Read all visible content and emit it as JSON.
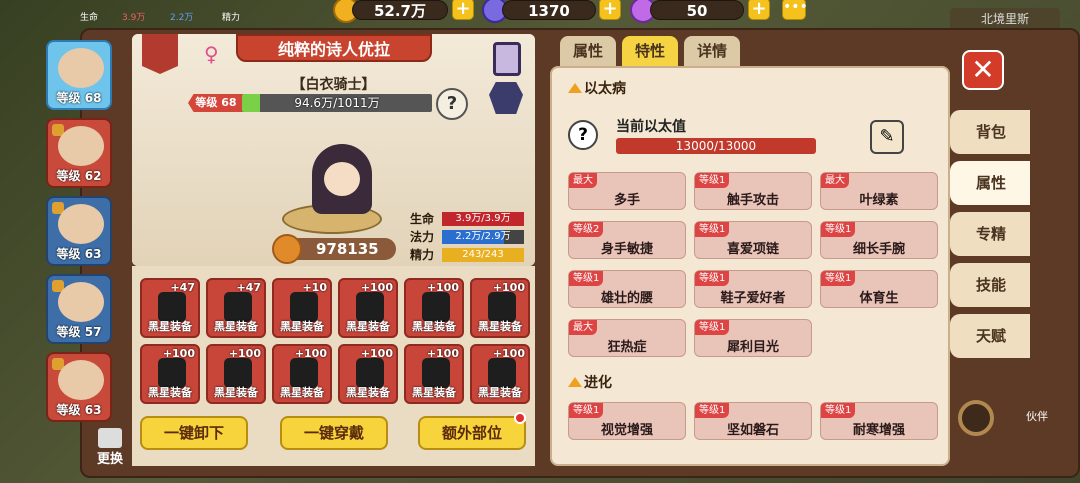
{
  "top": {
    "hud_hp": "生命",
    "hud_hp_value": "3.9万",
    "hud_mp_value": "2.2万",
    "hud_sp": "精力",
    "gold": "52.7万",
    "gems": "1370",
    "crystals": "50",
    "map_name": "北境里斯"
  },
  "heroes": [
    {
      "level": "等级 68",
      "selected": true
    },
    {
      "level": "等级 62"
    },
    {
      "level": "等级 63"
    },
    {
      "level": "等级 57"
    },
    {
      "level": "等级 63"
    }
  ],
  "swap_label": "更换",
  "character": {
    "name": "纯粹的诗人优拉",
    "subtitle": "【白衣骑士】",
    "level_label": "等级 68",
    "xp_text": "94.6万/1011万",
    "xp_fraction": 0.094,
    "help": "?",
    "power": "978135",
    "stats": [
      {
        "label": "生命",
        "value": "3.9万/3.9万",
        "fraction": 1.0,
        "color": "#c0262c"
      },
      {
        "label": "法力",
        "value": "2.2万/2.9万",
        "fraction": 0.76,
        "color": "#2a6fd0"
      },
      {
        "label": "精力",
        "value": "243/243",
        "fraction": 1.0,
        "color": "#e8b020"
      }
    ]
  },
  "equipment": [
    {
      "plus": "+47",
      "name": "黑星装备"
    },
    {
      "plus": "+47",
      "name": "黑星装备"
    },
    {
      "plus": "+10",
      "name": "黑星装备"
    },
    {
      "plus": "+100",
      "name": "黑星装备"
    },
    {
      "plus": "+100",
      "name": "黑星装备"
    },
    {
      "plus": "+100",
      "name": "黑星装备"
    },
    {
      "plus": "+100",
      "name": "黑星装备"
    },
    {
      "plus": "+100",
      "name": "黑星装备"
    },
    {
      "plus": "+100",
      "name": "黑星装备"
    },
    {
      "plus": "+100",
      "name": "黑星装备"
    },
    {
      "plus": "+100",
      "name": "黑星装备"
    },
    {
      "plus": "+100",
      "name": "黑星装备"
    }
  ],
  "buttons": {
    "unequip_all": "一键卸下",
    "equip_all": "一键穿戴",
    "extra_slots": "额外部位"
  },
  "tabs": [
    "属性",
    "特性",
    "详情"
  ],
  "active_tab": "特性",
  "ether": {
    "section": "以太病",
    "help": "?",
    "label": "当前以太值",
    "value_text": "13000/13000",
    "fraction": 1.0
  },
  "traits": [
    {
      "tag": "最大",
      "name": "多手"
    },
    {
      "tag": "等级1",
      "name": "触手攻击"
    },
    {
      "tag": "最大",
      "name": "叶绿素"
    },
    {
      "tag": "等级2",
      "name": "身手敏捷"
    },
    {
      "tag": "等级1",
      "name": "喜爱项链"
    },
    {
      "tag": "等级1",
      "name": "细长手腕"
    },
    {
      "tag": "等级1",
      "name": "雄壮的腰"
    },
    {
      "tag": "等级1",
      "name": "鞋子爱好者"
    },
    {
      "tag": "等级1",
      "name": "体育生"
    },
    {
      "tag": "最大",
      "name": "狂热症"
    },
    {
      "tag": "等级1",
      "name": "犀利目光"
    }
  ],
  "evolution": {
    "section": "进化",
    "traits": [
      {
        "tag": "等级1",
        "name": "视觉增强"
      },
      {
        "tag": "等级1",
        "name": "坚如磐石"
      },
      {
        "tag": "等级1",
        "name": "耐寒增强"
      }
    ]
  },
  "side_tabs": [
    "背包",
    "属性",
    "专精",
    "技能",
    "天赋"
  ],
  "side_active": "属性",
  "close": "✕",
  "partner_label": "伙伴",
  "colors": {
    "accent": "#f6d342",
    "trait_bg": "#e9c4b8",
    "tag_red": "#dd4444"
  }
}
